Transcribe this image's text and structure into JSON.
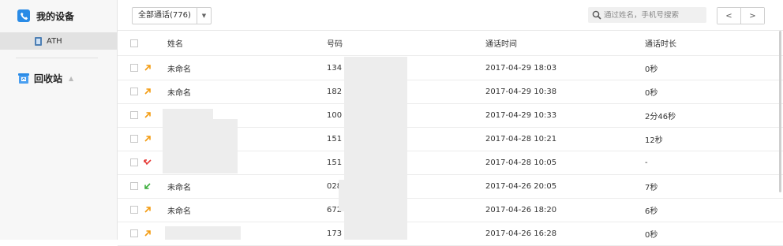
{
  "sidebar": {
    "my_devices": "我的设备",
    "device_name": "ATH",
    "recycle_bin": "回收站"
  },
  "toolbar": {
    "filter_label": "全部通话(776)",
    "search_placeholder": "通过姓名，手机号搜索",
    "prev": "<",
    "next": ">"
  },
  "table": {
    "headers": {
      "name": "姓名",
      "number": "号码",
      "time": "通话时间",
      "duration": "通话时长"
    },
    "rows": [
      {
        "dir": "outgoing",
        "name": "未命名",
        "number": "134",
        "time": "2017-04-29 18:03",
        "duration": "0秒"
      },
      {
        "dir": "outgoing",
        "name": "未命名",
        "number": "182",
        "time": "2017-04-29 10:38",
        "duration": "0秒"
      },
      {
        "dir": "outgoing",
        "name": "",
        "number": "100",
        "time": "2017-04-29 10:33",
        "duration": "2分46秒"
      },
      {
        "dir": "outgoing",
        "name": "",
        "number": "151",
        "time": "2017-04-28 10:21",
        "duration": "12秒"
      },
      {
        "dir": "missed",
        "name": "",
        "number": "151",
        "time": "2017-04-28 10:05",
        "duration": "-"
      },
      {
        "dir": "incoming",
        "name": "未命名",
        "number": "028",
        "time": "2017-04-26 20:05",
        "duration": "7秒"
      },
      {
        "dir": "outgoing",
        "name": "未命名",
        "number": "672",
        "time": "2017-04-26 18:20",
        "duration": "6秒"
      },
      {
        "dir": "outgoing",
        "name": "",
        "number": "173",
        "time": "2017-04-26 16:28",
        "duration": "0秒"
      }
    ]
  },
  "colors": {
    "outgoing": "#f39c12",
    "incoming": "#3cae3c",
    "missed": "#e53935",
    "accent": "#2a8be6"
  }
}
